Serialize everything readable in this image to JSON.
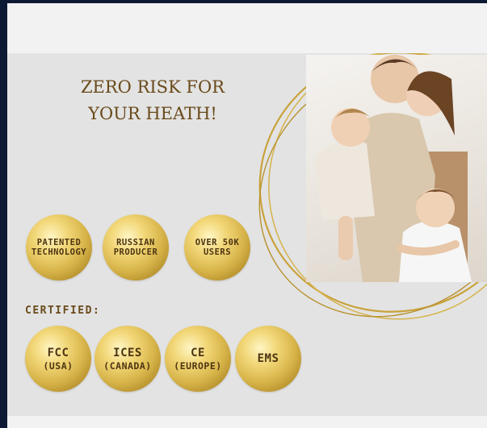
{
  "headline": {
    "line1": "ZERO RISK FOR",
    "line2": "YOUR HEATH!"
  },
  "badges_row1": [
    {
      "line1": "PATENTED",
      "line2": "TECHNOLOGY"
    },
    {
      "line1": "RUSSIAN",
      "line2": "PRODUCER"
    },
    {
      "line1": "OVER 50K",
      "line2": "USERS"
    }
  ],
  "certified_label": "CERTIFIED:",
  "badges_row2": [
    {
      "line1": "FCC",
      "line2": "(USA)"
    },
    {
      "line1": "ICES",
      "line2": "(CANADA)"
    },
    {
      "line1": "CE",
      "line2": "(EUROPE)"
    },
    {
      "line1": "EMS",
      "line2": ""
    }
  ],
  "photo": {
    "icon": "family-hug-photo"
  },
  "colors": {
    "gold": "#c9a23a",
    "text_brown": "#6a4a1b",
    "panel_bg": "#e3e3e3",
    "frame_bg": "#0c1a33"
  }
}
